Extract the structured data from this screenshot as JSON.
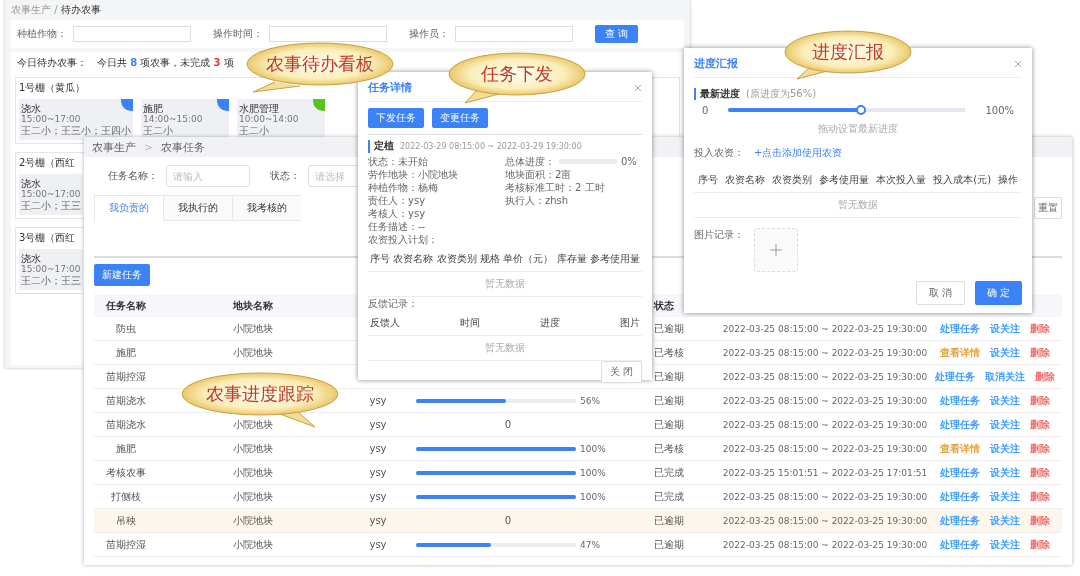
{
  "kanban": {
    "breadcrumb": "农事生产 / **待办农事**",
    "filters": [
      {
        "label": "种植作物："
      },
      {
        "label": "操作时间："
      },
      {
        "label": "操作员："
      }
    ],
    "search_button": "查 询",
    "summary": {
      "label": "今日待办农事：",
      "parts": [
        {
          "text": "今日共 "
        },
        {
          "text": "8",
          "color": "#3b82f6"
        },
        {
          "text": " 项农事，未完成 "
        },
        {
          "text": "3",
          "color": "#e53935"
        },
        {
          "text": " 项"
        }
      ]
    },
    "boards": [
      {
        "title": "1号棚（黄瓜）",
        "cards": [
          {
            "name": "浇水",
            "time": "15:00~17:00",
            "people": "王二小；王三小；王四小",
            "color": "#3b82f6"
          },
          {
            "name": "施肥",
            "time": "14:00~15:00",
            "people": "王二小",
            "color": "#3b82f6"
          },
          {
            "name": "水肥管理",
            "time": "10:00~14:00",
            "people": "王二小",
            "color": "#52c41a"
          }
        ]
      },
      {
        "title": "2号棚（西红",
        "cards": [
          {
            "name": "浇水",
            "time": "15:00~17:00",
            "people": "王二小；王三"
          }
        ]
      },
      {
        "title": "3号棚（西红",
        "cards": [
          {
            "name": "浇水",
            "time": "15:00~17:00",
            "people": "王二小；王三"
          }
        ]
      }
    ]
  },
  "task_list": {
    "breadcrumb": [
      {
        "label": "农事生产"
      },
      {
        "label": "农事任务"
      }
    ],
    "breadcrumb_separator": ">",
    "filters": [
      {
        "label": "任务名称：",
        "placeholder": "请输入",
        "kind": "input"
      },
      {
        "label": "状态：",
        "placeholder": "请选择",
        "kind": "select"
      }
    ],
    "tabs": [
      {
        "label": "我负责的",
        "selected": true
      },
      {
        "label": "我执行的",
        "selected": false
      },
      {
        "label": "我考核的",
        "selected": false
      }
    ],
    "reset_button": "重置",
    "new_button": "新建任务",
    "columns": {
      "column_1": "任务名称",
      "column_2": "地块名称",
      "column_5": "状态"
    },
    "rows": [
      {
        "name": "防虫",
        "plot": "小院地块",
        "status": "已逾期",
        "time": "2022-03-25 08:15:00 ~ 2022-03-25 19:30:00",
        "highlighted": false,
        "actions": [
          {
            "label": "处理任务",
            "color": "#409eff"
          },
          {
            "label": "设关注",
            "color": "#409eff"
          },
          {
            "label": "删除",
            "color": "#f56c6c"
          }
        ]
      },
      {
        "name": "施肥",
        "plot": "小院地块",
        "status": "已考核",
        "time": "2022-03-25 08:15:00 ~ 2022-03-25 19:30:00",
        "highlighted": false,
        "actions": [
          {
            "label": "查看详情",
            "color": "#e6a23c"
          },
          {
            "label": "设关注",
            "color": "#409eff"
          },
          {
            "label": "删除",
            "color": "#f56c6c"
          }
        ]
      },
      {
        "name": "苗期控湿",
        "status": "已逾期",
        "time": "2022-03-25 08:15:00 ~ 2022-03-25 19:30:00",
        "highlighted": false,
        "actions": [
          {
            "label": "处理任务",
            "color": "#409eff"
          },
          {
            "label": "取消关注",
            "color": "#409eff"
          },
          {
            "label": "删除",
            "color": "#f56c6c"
          }
        ]
      },
      {
        "name": "苗期浇水",
        "owner": "ysy",
        "progress": {
          "kind": "bar",
          "level": 0.56,
          "reading": "56%"
        },
        "status": "已逾期",
        "time": "2022-03-25 08:15:00 ~ 2022-03-25 19:30:00",
        "highlighted": false,
        "actions": [
          {
            "label": "处理任务",
            "color": "#409eff"
          },
          {
            "label": "设关注",
            "color": "#409eff"
          },
          {
            "label": "删除",
            "color": "#f56c6c"
          }
        ]
      },
      {
        "name": "苗期浇水",
        "plot": "小院地块",
        "owner": "ysy",
        "progress": {
          "kind": "text",
          "reading": "0"
        },
        "status": "已逾期",
        "time": "2022-03-25 08:15:00 ~ 2022-03-25 19:30:00",
        "highlighted": false,
        "actions": [
          {
            "label": "处理任务",
            "color": "#409eff"
          },
          {
            "label": "设关注",
            "color": "#409eff"
          },
          {
            "label": "删除",
            "color": "#f56c6c"
          }
        ]
      },
      {
        "name": "施肥",
        "plot": "小院地块",
        "owner": "ysy",
        "progress": {
          "kind": "bar",
          "level": 1,
          "reading": "100%"
        },
        "status": "已考核",
        "time": "2022-03-25 08:15:00 ~ 2022-03-25 19:30:00",
        "highlighted": false,
        "actions": [
          {
            "label": "查看详情",
            "color": "#e6a23c"
          },
          {
            "label": "设关注",
            "color": "#409eff"
          },
          {
            "label": "删除",
            "color": "#f56c6c"
          }
        ]
      },
      {
        "name": "考核农事",
        "plot": "小院地块",
        "owner": "ysy",
        "progress": {
          "kind": "bar",
          "level": 1,
          "reading": "100%"
        },
        "status": "已完成",
        "time": "2022-03-25 15:01:51 ~ 2022-03-25 17:01:51",
        "highlighted": false,
        "actions": [
          {
            "label": "处理任务",
            "color": "#409eff"
          },
          {
            "label": "设关注",
            "color": "#409eff"
          },
          {
            "label": "删除",
            "color": "#f56c6c"
          }
        ]
      },
      {
        "name": "打侧枝",
        "plot": "小院地块",
        "owner": "ysy",
        "progress": {
          "kind": "bar",
          "level": 1,
          "reading": "100%"
        },
        "status": "已完成",
        "time": "2022-03-25 08:15:00 ~ 2022-03-25 19:30:00",
        "highlighted": false,
        "actions": [
          {
            "label": "处理任务",
            "color": "#409eff"
          },
          {
            "label": "设关注",
            "color": "#409eff"
          },
          {
            "label": "删除",
            "color": "#f56c6c"
          }
        ]
      },
      {
        "name": "吊秧",
        "plot": "小院地块",
        "owner": "ysy",
        "progress": {
          "kind": "text",
          "reading": "0"
        },
        "status": "已逾期",
        "time": "2022-03-25 08:15:00 ~ 2022-03-25 19:30:00",
        "highlighted": true,
        "actions": [
          {
            "label": "处理任务",
            "color": "#409eff"
          },
          {
            "label": "设关注",
            "color": "#409eff"
          },
          {
            "label": "删除",
            "color": "#f56c6c"
          }
        ]
      },
      {
        "name": "苗期控湿",
        "plot": "小院地块",
        "owner": "ysy",
        "progress": {
          "kind": "bar",
          "level": 0.47,
          "reading": "47%"
        },
        "status": "已逾期",
        "time": "2022-03-25 08:15:00 ~ 2022-03-25 19:30:00",
        "highlighted": false,
        "actions": [
          {
            "label": "处理任务",
            "color": "#409eff"
          },
          {
            "label": "设关注",
            "color": "#409eff"
          },
          {
            "label": "删除",
            "color": "#f56c6c"
          }
        ]
      }
    ]
  },
  "task_detail": {
    "title": "任务详情",
    "buttons": [
      "下发任务",
      "变更任务"
    ],
    "section": "定植",
    "date_range": "2022-03-29 08:15:00 ~ 2022-03-29 19:30:00",
    "fields": [
      {
        "label": "状态：",
        "value": "未开始",
        "kind": "text"
      },
      {
        "label": "总体进度：",
        "kind": "progress",
        "level": 0,
        "reading": "0%"
      },
      {
        "label": "劳作地块：",
        "value": "小院地块",
        "kind": "text"
      },
      {
        "label": "地块面积：",
        "value": "2亩",
        "kind": "text"
      },
      {
        "label": "种植作物：",
        "value": "杨梅",
        "kind": "text"
      },
      {
        "label": "考核标准工时：",
        "value": "2 工时",
        "kind": "text"
      },
      {
        "label": "责任人：",
        "value": "ysy",
        "kind": "text"
      },
      {
        "label": "执行人：",
        "value": "zhsh",
        "kind": "text"
      },
      {
        "label": "考核人：",
        "value": "ysy",
        "kind": "wide"
      },
      {
        "label": "任务描述：",
        "value": "--",
        "kind": "wide"
      }
    ],
    "plan": {
      "label": "农资投入计划：",
      "columns": [
        "序号",
        "农资名称",
        "农资类别",
        "规格",
        "单价（元）",
        "库存量",
        "参考使用量"
      ],
      "empty": "暂无数据"
    },
    "feedback": {
      "label": "反馈记录：",
      "columns": [
        "反馈人",
        "时间",
        "进度",
        "图片"
      ],
      "empty": "暂无数据"
    },
    "close_button": "关 闭"
  },
  "progress_report": {
    "title": "进度汇报",
    "section": "最新进度",
    "note": "(原进度为56%)",
    "slider": {
      "min": "0",
      "max": "100%",
      "level": 0.56
    },
    "hint": "拖动设置最新进度",
    "inputs_label": "投入农资：",
    "add_link": "+点击添加使用农资",
    "columns": [
      "序号",
      "农资名称",
      "农资类别",
      "参考使用量",
      "本次投入量",
      "投入成本(元)",
      "操作"
    ],
    "empty": "暂无数据",
    "photo_label": "图片记录：",
    "cancel_button": "取 消",
    "ok_button": "确 定"
  },
  "callouts": [
    {
      "text": "农事待办看板"
    },
    {
      "text": "任务下发"
    },
    {
      "text": "进度汇报"
    },
    {
      "text": "农事进度跟踪"
    }
  ]
}
